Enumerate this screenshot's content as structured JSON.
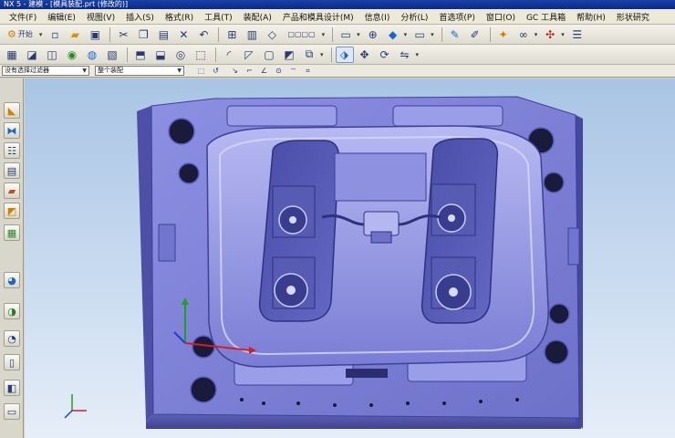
{
  "window": {
    "title": "NX 5 - 建模 - [模具装配.prt (修改的)]"
  },
  "menus": [
    "文件(F)",
    "编辑(E)",
    "视图(V)",
    "插入(S)",
    "格式(R)",
    "工具(T)",
    "装配(A)",
    "产品和模具设计(M)",
    "信息(I)",
    "分析(L)",
    "首选项(P)",
    "窗口(O)",
    "GC 工具箱",
    "帮助(H)",
    "形状研究"
  ],
  "toolbar": {
    "start_label": "开始"
  },
  "selection_bar": {
    "filter_value": "没有选择过滤器",
    "scope_value": "整个装配"
  },
  "icons": {
    "start": "start-icon",
    "new": "new-file-icon",
    "open": "open-folder-icon",
    "save": "save-icon",
    "cut": "cut-icon",
    "copy": "copy-icon",
    "paste": "paste-icon",
    "delete": "delete-icon",
    "undo": "undo-icon",
    "fit": "fit-view-icon",
    "shaded": "shaded-icon",
    "wireframe": "wireframe-icon",
    "snap": "snap-icon"
  },
  "colors": {
    "titlebar": "#0a2a86",
    "model": "#7c7fd6",
    "model_dark": "#4b4ea8",
    "viewport_top": "#a9c4e4",
    "viewport_bottom": "#e6eef8"
  }
}
